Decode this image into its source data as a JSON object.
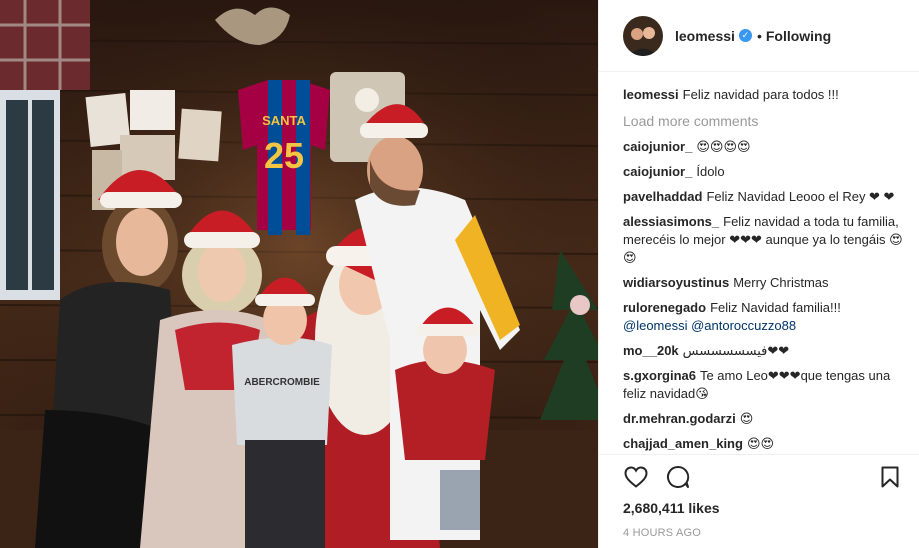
{
  "post": {
    "author": "leomessi",
    "follow_status": "Following",
    "dot": "•",
    "verified_glyph": "✓",
    "caption_text": "Feliz navidad para todos !!!",
    "load_more": "Load more comments",
    "photo_text": {
      "jersey_name": "SANTA",
      "jersey_number": "25",
      "shirt_text": "ABERCROMBIE"
    }
  },
  "comments": [
    {
      "user": "caiojunior_",
      "text": "😍😍😍😍",
      "mention": ""
    },
    {
      "user": "caiojunior_",
      "text": "Ídolo",
      "mention": ""
    },
    {
      "user": "pavelhaddad",
      "text": "Feliz Navidad Leooo el Rey ❤ ❤",
      "mention": ""
    },
    {
      "user": "alessiasimons_",
      "text": "Feliz navidad a toda tu familia, merecéis lo mejor ❤❤❤ aunque ya lo tengáis 😍😍",
      "mention": ""
    },
    {
      "user": "widiarsoyustinus",
      "text": "Merry Christmas",
      "mention": ""
    },
    {
      "user": "rulorenegado",
      "text": "Feliz Navidad familia!!!",
      "mention": "@leomessi @antoroccuzzo88"
    },
    {
      "user": "mo__20k",
      "text": "فيسسسسسس❤❤",
      "mention": ""
    },
    {
      "user": "s.gxorgina6",
      "text": "Te amo Leo❤❤❤que tengas una feliz navidad😘",
      "mention": ""
    },
    {
      "user": "dr.mehran.godarzi",
      "text": "😍",
      "mention": ""
    },
    {
      "user": "chajjad_amen_king",
      "text": "😍😍",
      "mention": ""
    }
  ],
  "footer": {
    "likes": "2,680,411 likes",
    "time": "4 HOURS AGO"
  },
  "icons": {
    "like": "heart-icon",
    "comment": "comment-bubble-icon",
    "save": "bookmark-icon",
    "verified": "verified-badge-icon"
  },
  "colors": {
    "verified_blue": "#3897f0",
    "text_primary": "#262626",
    "text_secondary": "#999999",
    "mention": "#003569",
    "divider": "#efefef"
  }
}
